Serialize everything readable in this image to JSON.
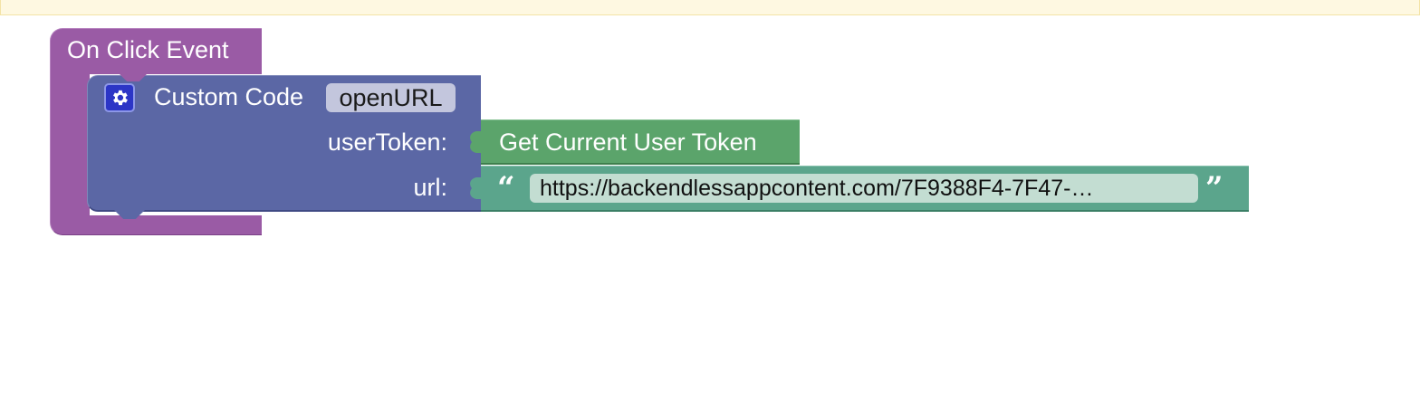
{
  "workspace": {
    "event_block": {
      "label": "On Click Event",
      "color": "#9a5ba5"
    },
    "custom_code_block": {
      "label": "Custom Code",
      "function_name": "openURL",
      "icon": "gear-icon",
      "color": "#5b67a5",
      "args": [
        {
          "label": "userToken:"
        },
        {
          "label": "url:"
        }
      ]
    },
    "get_token_block": {
      "label": "Get Current User Token",
      "color": "#5ba46b"
    },
    "url_string_block": {
      "open_quote": "“",
      "close_quote": "”",
      "value": "https://backendlessappcontent.com/7F9388F4-7F47-…",
      "color": "#5ba58c"
    }
  },
  "banner": {
    "color": "#fef8e1"
  }
}
